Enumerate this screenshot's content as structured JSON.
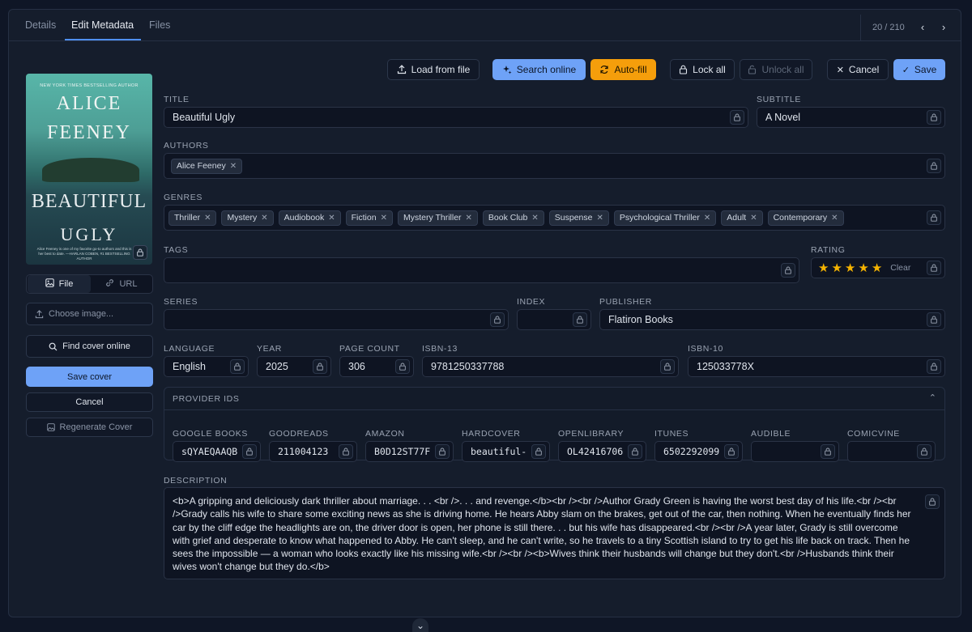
{
  "tabs": [
    {
      "label": "Details"
    },
    {
      "label": "Edit Metadata"
    },
    {
      "label": "Files"
    }
  ],
  "pager": {
    "count": "20 / 210"
  },
  "toolbar": {
    "load_from_file": "Load from file",
    "search_online": "Search online",
    "auto_fill": "Auto-fill",
    "lock_all": "Lock all",
    "unlock_all": "Unlock all",
    "cancel": "Cancel",
    "save": "Save"
  },
  "cover": {
    "tagline": "NEW YORK TIMES BESTSELLING AUTHOR",
    "author_line1": "ALICE",
    "author_line2": "FEENEY",
    "title_line1": "BEAUTIFUL",
    "title_line2": "UGLY",
    "blurb": "Alice Feeney is one of my favorite go-to authors and this is her best to date. —HARLAN COBEN, #1 BESTSELLING AUTHOR"
  },
  "cover_panel": {
    "file_tab": "File",
    "url_tab": "URL",
    "choose_image": "Choose image...",
    "find_cover": "Find cover online",
    "save_cover": "Save cover",
    "cancel": "Cancel",
    "regenerate": "Regenerate Cover"
  },
  "fields": {
    "title_label": "TITLE",
    "title": "Beautiful Ugly",
    "subtitle_label": "SUBTITLE",
    "subtitle": "A Novel",
    "authors_label": "AUTHORS",
    "authors": [
      "Alice Feeney"
    ],
    "genres_label": "GENRES",
    "genres": [
      "Thriller",
      "Mystery",
      "Audiobook",
      "Fiction",
      "Mystery Thriller",
      "Book Club",
      "Suspense",
      "Psychological Thriller",
      "Adult",
      "Contemporary"
    ],
    "tags_label": "TAGS",
    "rating_label": "RATING",
    "rating": 5,
    "rating_clear": "Clear",
    "series_label": "SERIES",
    "series": "",
    "index_label": "INDEX",
    "index": "",
    "publisher_label": "PUBLISHER",
    "publisher": "Flatiron Books",
    "language_label": "LANGUAGE",
    "language": "English",
    "year_label": "YEAR",
    "year": "2025",
    "page_count_label": "PAGE COUNT",
    "page_count": "306",
    "isbn13_label": "ISBN-13",
    "isbn13": "9781250337788",
    "isbn10_label": "ISBN-10",
    "isbn10": "125033778X"
  },
  "providers": {
    "heading": "PROVIDER IDS",
    "items": [
      {
        "label": "GOOGLE BOOKS",
        "value": "sQYAEQAAQB"
      },
      {
        "label": "GOODREADS",
        "value": "211004123"
      },
      {
        "label": "AMAZON",
        "value": "B0D12ST77F"
      },
      {
        "label": "HARDCOVER",
        "value": "beautiful-"
      },
      {
        "label": "OPENLIBRARY",
        "value": "OL42416706"
      },
      {
        "label": "ITUNES",
        "value": "6502292099"
      },
      {
        "label": "AUDIBLE",
        "value": ""
      },
      {
        "label": "COMICVINE",
        "value": ""
      }
    ]
  },
  "description": {
    "label": "DESCRIPTION",
    "text": "<b>A gripping and deliciously dark thriller about marriage. . . <br />. . . and revenge.</b><br /><br />Author Grady Green is having the worst best day of his life.<br /><br />Grady calls his wife to share some exciting news as she is driving home. He hears Abby slam on the brakes, get out of the car, then nothing. When he eventually finds her car by the cliff edge the headlights are on, the driver door is open, her phone is still there. . . but his wife has disappeared.<br /><br />A year later, Grady is still overcome with grief and desperate to know what happened to Abby. He can't sleep, and he can't write, so he travels to a tiny Scottish island to try to get his life back on track. Then he sees the impossible — a woman who looks exactly like his missing wife.<br /><br /><b>Wives think their husbands will change but they don't.<br />Husbands think their wives won't change but they do.</b>"
  },
  "colors": {
    "accent": "#6ea2f7",
    "autofill": "#f59e0b",
    "star": "#f5b301",
    "background": "#0f1626"
  }
}
